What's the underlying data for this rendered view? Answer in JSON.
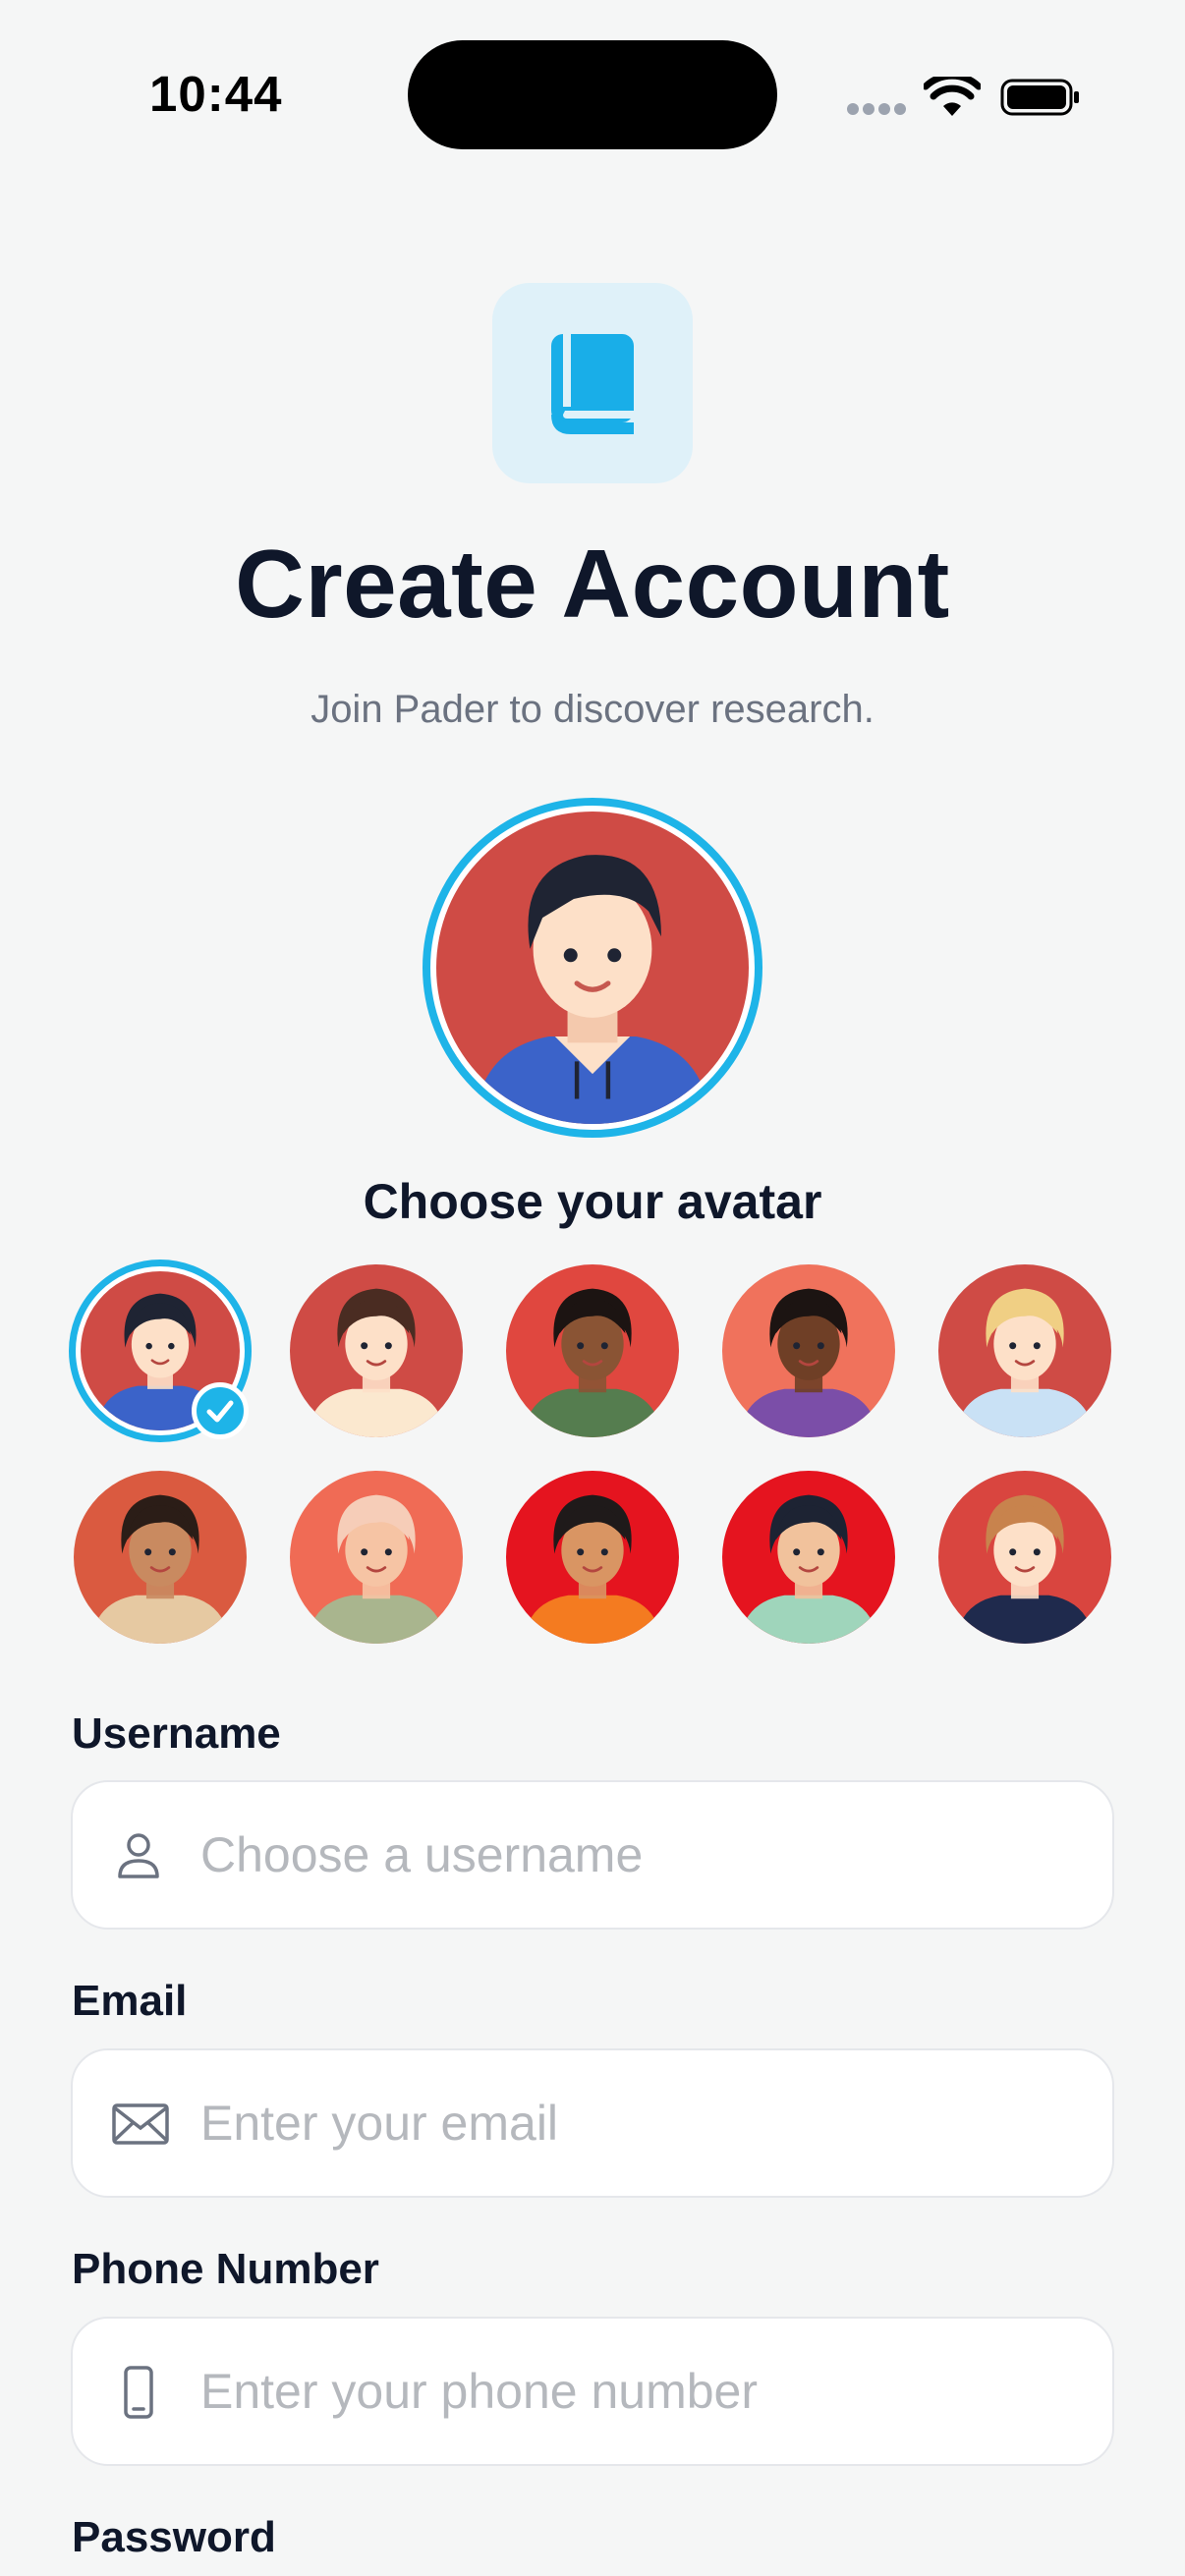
{
  "status_bar": {
    "time": "10:44"
  },
  "header": {
    "title": "Create Account",
    "subtitle": "Join Pader to discover research."
  },
  "avatar_picker": {
    "label": "Choose your avatar",
    "selected_index": 0,
    "avatars": [
      {
        "bg": "#cf4b45",
        "skin": "#fde0c8",
        "hair": "#1f2433",
        "shirt": "#3b63c9"
      },
      {
        "bg": "#cf4b45",
        "skin": "#fde0c8",
        "hair": "#4a2c22",
        "shirt": "#fbe8cf"
      },
      {
        "bg": "#e0473f",
        "skin": "#8a5434",
        "hair": "#1c1412",
        "shirt": "#557d4f"
      },
      {
        "bg": "#f0725c",
        "skin": "#6f3f26",
        "hair": "#1c1412",
        "shirt": "#7b4ea8"
      },
      {
        "bg": "#cf4b45",
        "skin": "#fde0c8",
        "hair": "#f0cf84",
        "shirt": "#c9e1f5"
      },
      {
        "bg": "#da5a40",
        "skin": "#c98a60",
        "hair": "#2b1d17",
        "shirt": "#e6c9a2"
      },
      {
        "bg": "#f06b55",
        "skin": "#f6c4a4",
        "hair": "#f6cdb8",
        "shirt": "#a9b58e"
      },
      {
        "bg": "#e5141f",
        "skin": "#d99563",
        "hair": "#1f1a1a",
        "shirt": "#f47b20"
      },
      {
        "bg": "#e5141f",
        "skin": "#f1c29c",
        "hair": "#1d2333",
        "shirt": "#9fd5bb"
      },
      {
        "bg": "#d9453f",
        "skin": "#fde0c8",
        "hair": "#c8834d",
        "shirt": "#1f2a4d"
      }
    ]
  },
  "form": {
    "username": {
      "label": "Username",
      "placeholder": "Choose a username",
      "icon": "person-icon"
    },
    "email": {
      "label": "Email",
      "placeholder": "Enter your email",
      "icon": "envelope-icon"
    },
    "phone": {
      "label": "Phone Number",
      "placeholder": "Enter your phone number",
      "icon": "phone-icon"
    },
    "password": {
      "label": "Password"
    }
  },
  "colors": {
    "accent": "#1eb4e8",
    "background": "#f5f6f6",
    "text": "#0f172a"
  }
}
